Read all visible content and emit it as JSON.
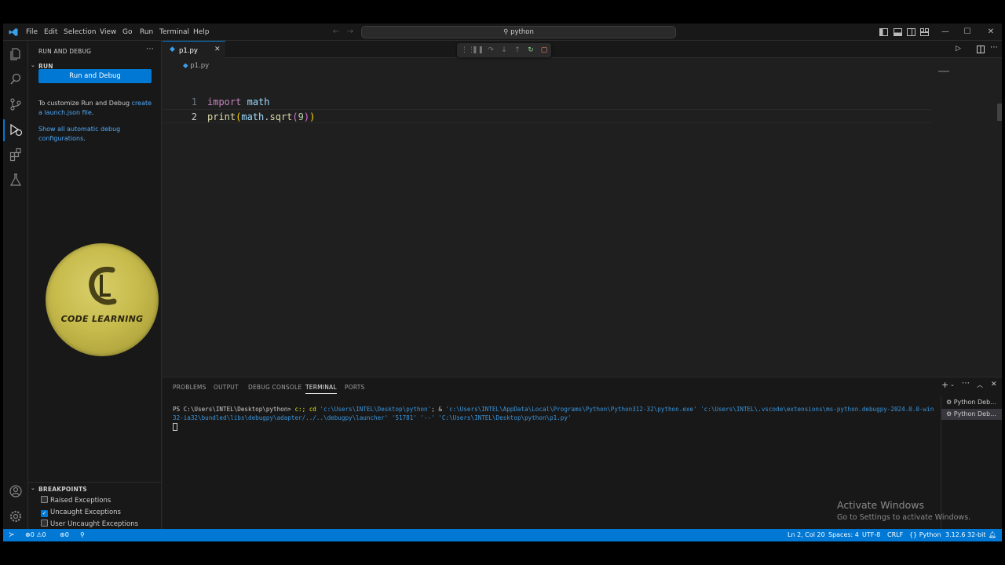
{
  "titlebar": {
    "menus": [
      "File",
      "Edit",
      "Selection",
      "View",
      "Go",
      "Run",
      "Terminal",
      "Help"
    ],
    "search_text": "python"
  },
  "sidebar": {
    "header": "RUN AND DEBUG",
    "section_run": "RUN",
    "run_button": "Run and Debug",
    "customize_text": "To customize Run and Debug ",
    "customize_link": "create a launch.json file",
    "customize_end": ".",
    "show_all_link": "Show all automatic debug configurations",
    "show_all_end": ".",
    "breakpoints_header": "BREAKPOINTS",
    "breakpoints": [
      {
        "label": "Raised Exceptions",
        "checked": false
      },
      {
        "label": "Uncaught Exceptions",
        "checked": true
      },
      {
        "label": "User Uncaught Exceptions",
        "checked": false
      }
    ]
  },
  "logo": {
    "text": "CODE LEARNING",
    "colors": {
      "gold": "#c7bb4c",
      "dark": "#2a2510"
    }
  },
  "editor": {
    "tab_label": "p1.py",
    "breadcrumb": "p1.py",
    "lines": [
      {
        "number": "1"
      },
      {
        "number": "2"
      }
    ],
    "code": {
      "l1_kw": "import",
      "l1_mod": "math",
      "l2_fn": "print",
      "l2_open": "(",
      "l2_obj": "math",
      "l2_dot": ".",
      "l2_call": "sqrt",
      "l2_open2": "(",
      "l2_num": "9",
      "l2_close2": ")",
      "l2_close": ")"
    }
  },
  "panel": {
    "tabs": [
      "PROBLEMS",
      "OUTPUT",
      "DEBUG CONSOLE",
      "TERMINAL",
      "PORTS"
    ],
    "active_tab": "TERMINAL",
    "terminal": {
      "prompt": "PS C:\\Users\\INTEL\\Desktop\\python> ",
      "cmd1": " c:; cd ",
      "arg1": "'c:\\Users\\INTEL\\Desktop\\python'",
      "sep": "; & ",
      "arg2": "'c:\\Users\\INTEL\\AppData\\Local\\Programs\\Python\\Python312-32\\python.exe'",
      "arg3": "'c:\\Users\\INTEL\\.vscode\\extensions\\ms-python.debugpy-2024.0.0-win32-ia32\\bundled\\libs\\debugpy\\adapter/../..\\debugpy\\launcher'",
      "arg4": "'51781'",
      "arg5": "'--'",
      "arg6": "'C:\\Users\\INTEL\\Desktop\\python\\p1.py'"
    },
    "terminal_list": [
      "Python Deb...",
      "Python Deb..."
    ]
  },
  "statusbar": {
    "problems_errors": "0",
    "problems_warnings": "0",
    "ports": "0",
    "cursor": "Ln 2, Col 20",
    "spaces": "Spaces: 4",
    "encoding": "UTF-8",
    "eol": "CRLF",
    "language": "Python",
    "interpreter": "3.12.6 32-bit",
    "color": "#0078d4"
  },
  "watermark": {
    "title": "Activate Windows",
    "subtitle": "Go to Settings to activate Windows."
  }
}
